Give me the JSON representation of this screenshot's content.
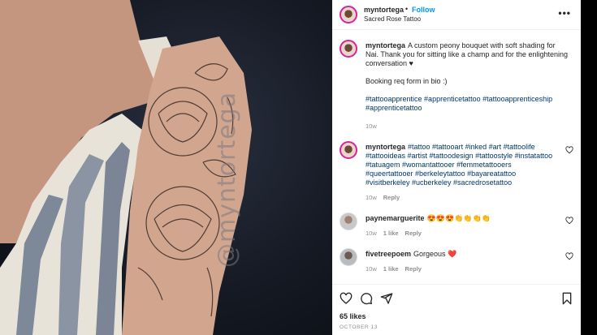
{
  "image": {
    "watermark": "@myntortega"
  },
  "header": {
    "username": "myntortega",
    "separator": "•",
    "follow_label": "Follow",
    "location": "Sacred Rose Tattoo",
    "more_label": "•••"
  },
  "comments": [
    {
      "username": "myntortega",
      "caption_line1": "A custom peony bouquet with soft shading for Nai. Thank you for sitting like a champ and for the enlightening conversation ♥",
      "caption_line2": "Booking req form in bio :)",
      "caption_tags": "#tattooapprentice #apprenticetattoo #tattooapprenticeship #apprenticetattoo",
      "time": "10w"
    },
    {
      "username": "myntortega",
      "text": "#tattoo #tattooart #inked #art #tattoolife #tattooideas #artist #tattoodesign #tattoostyle #instatattoo #tatuagem #womantattooer #femmetattooers #queertattooer #berkeleytattoo #bayareatattoo #visitberkeley #ucberkeley #sacredrosetattoo",
      "time": "10w",
      "reply": "Reply"
    },
    {
      "username": "paynemarguerite",
      "text": "😍😍😍👏👏👏👏",
      "time": "10w",
      "likes": "1 like",
      "reply": "Reply"
    },
    {
      "username": "fivetreepoem",
      "text": "Gorgeous ❤️",
      "time": "10w",
      "likes": "1 like",
      "reply": "Reply"
    }
  ],
  "footer": {
    "likes": "65 likes",
    "date": "OCTOBER 13"
  },
  "colors": {
    "link_blue": "#0095f6",
    "hashtag": "#00376b",
    "muted": "#8e8e8e"
  }
}
